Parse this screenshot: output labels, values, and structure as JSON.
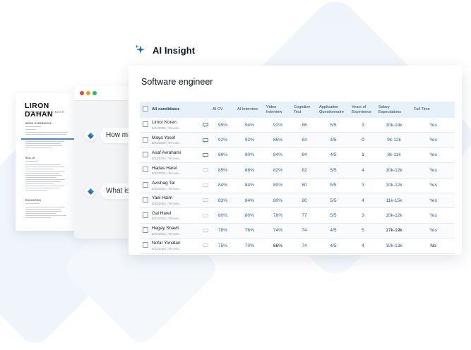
{
  "header": {
    "title": "AI Insight"
  },
  "resume": {
    "name": "LIRON DAHAN",
    "role": "SOFTWARE ENGINEER",
    "sections": [
      "WORK EXPERIENCE",
      "SKILLS",
      "EDUCATION"
    ]
  },
  "chat": {
    "messages": [
      "How many years of experience",
      "What is your salary expectation"
    ]
  },
  "panel": {
    "title": "Software engineer",
    "columns": [
      "All candidates",
      "AI CV",
      "AI Interview",
      "Video Interview",
      "Cognitive Test",
      "Application Questionnaire",
      "Years of Experience",
      "Salary Expectations",
      "Full Time"
    ],
    "rows": [
      {
        "name": "Limor Koren",
        "sub": "5/22/2023 | Tel-Aviv...",
        "ai_cv": "95%",
        "ai_interview": "94%",
        "video": "92%",
        "cognitive": "86",
        "questionnaire": "5/5",
        "years": "3",
        "salary": "10k-14k",
        "full_time": "Yes",
        "msg": "blue"
      },
      {
        "name": "Maya Yosef",
        "sub": "5/22/2023 | Tel-Aviv...",
        "ai_cv": "92%",
        "ai_interview": "92%",
        "video": "85%",
        "cognitive": "84",
        "questionnaire": "4/5",
        "years": "0",
        "salary": "9k-12k",
        "full_time": "Yes",
        "msg": "blue"
      },
      {
        "name": "Asaf Avrahami",
        "sub": "5/22/2023 | Tel-Aviv...",
        "ai_cv": "88%",
        "ai_interview": "90%",
        "video": "84%",
        "cognitive": "84",
        "questionnaire": "4/5",
        "years": "1",
        "salary": "8k-11k",
        "full_time": "Yes",
        "msg": "blue"
      },
      {
        "name": "Hadas Harel",
        "sub": "5/22/2023 | Tel-Aviv...",
        "ai_cv": "85%",
        "ai_interview": "88%",
        "video": "82%",
        "cognitive": "82",
        "questionnaire": "5/5",
        "years": "4",
        "salary": "10k-12k",
        "full_time": "Yes",
        "msg": "grey"
      },
      {
        "name": "Avishag Tal",
        "sub": "5/22/2023 | Tel-Aviv...",
        "ai_cv": "84%",
        "ai_interview": "84%",
        "video": "80%",
        "cognitive": "80",
        "questionnaire": "5/5",
        "years": "3",
        "salary": "10k-12k",
        "full_time": "Yes",
        "msg": "grey"
      },
      {
        "name": "Yael Haim",
        "sub": "5/22/2023 | Tel-Aviv...",
        "ai_cv": "83%",
        "ai_interview": "84%",
        "video": "80%",
        "cognitive": "80",
        "questionnaire": "5/5",
        "years": "4",
        "salary": "11k-15k",
        "full_time": "Yes",
        "msg": "grey"
      },
      {
        "name": "Gal Harel",
        "sub": "5/22/2023 | Tel-Aviv...",
        "ai_cv": "80%",
        "ai_interview": "80%",
        "video": "78%",
        "cognitive": "77",
        "questionnaire": "5/5",
        "years": "3",
        "salary": "10k-12k",
        "full_time": "Yes",
        "msg": "grey"
      },
      {
        "name": "Hagay Shavit",
        "sub": "5/22/2023 | Tel-Aviv...",
        "ai_cv": "78%",
        "ai_interview": "76%",
        "video": "74%",
        "cognitive": "74",
        "questionnaire": "4/5",
        "years": "5",
        "salary": "17k-19k",
        "full_time": "Yes",
        "msg": "grey"
      },
      {
        "name": "Nofar Yonatan",
        "sub": "5/22/2023 | Tel-Aviv...",
        "ai_cv": "75%",
        "ai_interview": "70%",
        "video": "66%",
        "cognitive": "74",
        "questionnaire": "4/5",
        "years": "4",
        "salary": "10k-13k",
        "full_time": "No",
        "msg": "grey"
      }
    ]
  },
  "colors": {
    "accent": "#2563a8",
    "header_row": "#e7f1fa",
    "sparkle": "#1f6fd1"
  },
  "icons": [
    "sparkle-icon",
    "bot-icon",
    "message-icon",
    "checkbox"
  ]
}
